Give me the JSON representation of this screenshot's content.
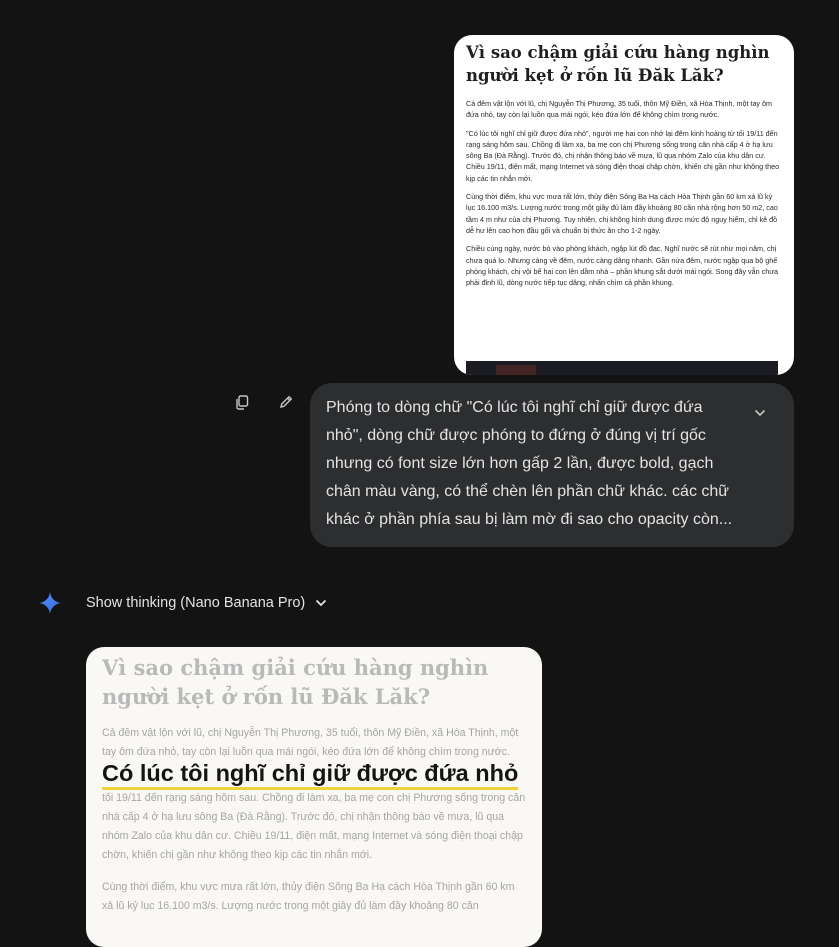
{
  "user_image": {
    "title": "Vì sao chậm giải cứu hàng nghìn người kẹt ở rốn lũ Đăk Lăk?",
    "paragraphs": [
      "Cả đêm vật lộn với lũ, chị Nguyễn Thị Phương, 35 tuổi, thôn Mỹ Điền, xã Hòa Thịnh, một tay ôm đứa nhỏ, tay còn lại luồn qua mái ngói, kéo đứa lớn để không chìm trong nước.",
      "\"Có lúc tôi nghĩ chỉ giữ được đứa nhỏ\", người mẹ hai con nhớ lại đêm kinh hoàng từ tối 19/11 đến rạng sáng hôm sau. Chồng đi làm xa, ba mẹ con chị Phương sống trong căn nhà cấp 4 ở hạ lưu sông Ba (Đà Rằng). Trước đó, chị nhận thông báo về mưa, lũ qua nhóm Zalo của khu dân cư. Chiều 19/11, điện mất, mạng Internet và sóng điện thoại chập chờn, khiến chị gần như không theo kịp các tin nhắn mới.",
      "Cùng thời điểm, khu vực mưa rất lớn, thủy điện Sông Ba Hạ cách Hòa Thịnh gần 60 km xả lũ kỷ lục 16.100 m3/s. Lượng nước trong một giây đủ làm đầy khoảng 80 căn nhà rộng hơn 50 m2, cao tầm 4 m như của chị Phương. Tuy nhiên, chị không hình dung được mức độ nguy hiểm, chỉ kê đồ dễ hư lên cao hơn đầu gối và chuẩn bị thức ăn cho 1-2 ngày.",
      "Chiều cùng ngày, nước bò vào phòng khách, ngập lút đồ đạc. Nghĩ nước sẽ rút như mọi năm, chị chưa quá lo. Nhưng càng về đêm, nước càng dâng nhanh. Gần nửa đêm, nước ngập qua bộ ghế phòng khách, chị vội bế hai con lên dầm nhà – phần khung sắt dưới mái ngói. Song đây vẫn chưa phải đỉnh lũ, dòng nước tiếp tục dâng, nhấn chìm cả phần khung."
    ]
  },
  "actions": {
    "copy_icon": "copy-icon",
    "edit_icon": "pencil-icon"
  },
  "prompt": {
    "text": "Phóng to dòng chữ \"Có lúc tôi nghĩ chỉ giữ được đứa nhỏ\", dòng chữ được phóng to đứng ở đúng vị trí gốc nhưng có font size lớn hơn gấp 2 lần, được bold, gạch chân màu vàng, có thể chèn lên phần chữ khác. các chữ khác ở phần phía sau bị làm mờ đi sao cho opacity còn...",
    "expand_icon": "chevron-down-icon"
  },
  "model": {
    "icon": "gemini-spark-icon",
    "thinking_label": "Show thinking (Nano Banana Pro)",
    "chevron_icon": "chevron-down-icon"
  },
  "generated_image": {
    "title": "Vì sao chậm giải cứu hàng nghìn người kẹt ở rốn lũ Đăk Lăk?",
    "paragraph1": "Cả đêm vật lộn với lũ, chị Nguyễn Thị Phương, 35 tuổi, thôn Mỹ Điền, xã Hòa Thịnh, một tay ôm đứa nhỏ, tay còn lại luồn qua mái ngói, kéo đứa lớn để không chìm trong nước.",
    "highlight": "Có lúc tôi nghĩ chỉ giữ được đứa nhỏ",
    "paragraph2": "tối 19/11 đến rạng sáng hôm sau. Chồng đi làm xa, ba mẹ con chị Phương sống trong căn nhà cấp 4 ở hạ lưu sông Ba (Đà Rằng). Trước đó, chị nhận thông báo về mưa, lũ qua nhóm Zalo của khu dân cư. Chiều 19/11, điện mất, mạng Internet và sóng điện thoại chập chờn, khiến chị gần như không theo kịp các tin nhắn mới.",
    "paragraph3": "Cùng thời điểm, khu vực mưa rất lớn, thủy điện Sông Ba Hạ cách Hòa Thịnh gần 60 km xả lũ kỷ lục 16.100 m3/s. Lượng nước trong một giây đủ làm đầy khoảng 80 căn",
    "highlight_underline_color": "#f2d23a"
  },
  "colors": {
    "background": "#131314",
    "bubble": "#2d2e30",
    "text": "#e3e3e3",
    "gemini_blue": "#4285f4"
  }
}
